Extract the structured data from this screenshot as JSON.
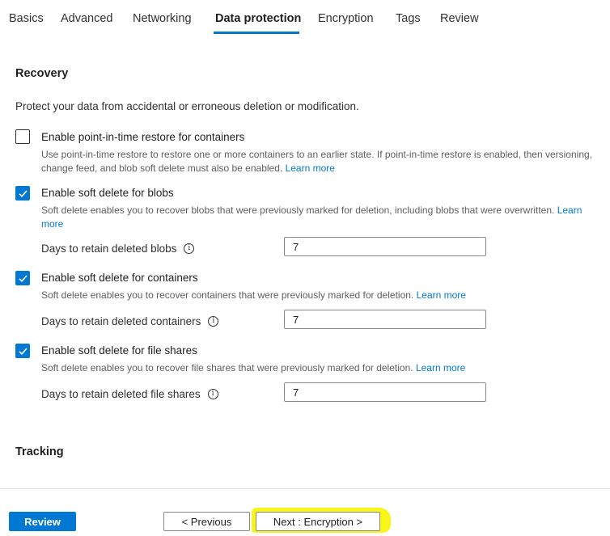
{
  "tabs": [
    {
      "label": "Basics"
    },
    {
      "label": "Advanced"
    },
    {
      "label": "Networking"
    },
    {
      "label": "Data protection"
    },
    {
      "label": "Encryption"
    },
    {
      "label": "Tags"
    },
    {
      "label": "Review"
    }
  ],
  "active_tab": "Data protection",
  "recovery": {
    "heading": "Recovery",
    "intro": "Protect your data from accidental or erroneous deletion or modification.",
    "pitr": {
      "label": "Enable point-in-time restore for containers",
      "checked": false,
      "description": "Use point-in-time restore to restore one or more containers to an earlier state. If point-in-time restore is enabled, then versioning, change feed, and blob soft delete must also be enabled.",
      "link": "Learn more"
    },
    "blobs": {
      "label": "Enable soft delete for blobs",
      "checked": true,
      "description": "Soft delete enables you to recover blobs that were previously marked for deletion, including blobs that were overwritten.",
      "link": "Learn more",
      "days_label": "Days to retain deleted blobs",
      "days_value": "7"
    },
    "containers": {
      "label": "Enable soft delete for containers",
      "checked": true,
      "description": "Soft delete enables you to recover containers that were previously marked for deletion.",
      "link": "Learn more",
      "days_label": "Days to retain deleted containers",
      "days_value": "7"
    },
    "fileshares": {
      "label": "Enable soft delete for file shares",
      "checked": true,
      "description": "Soft delete enables you to recover file shares that were previously marked for deletion.",
      "link": "Learn more",
      "days_label": "Days to retain deleted file shares",
      "days_value": "7"
    }
  },
  "tracking": {
    "heading": "Tracking"
  },
  "footer": {
    "review_label": "Review",
    "previous_label": "< Previous",
    "next_label": "Next : Encryption >"
  },
  "colors": {
    "accent": "#0078d4",
    "highlight": "#f7f400"
  },
  "icons": {
    "info": "info-icon",
    "check": "checkmark-icon"
  }
}
